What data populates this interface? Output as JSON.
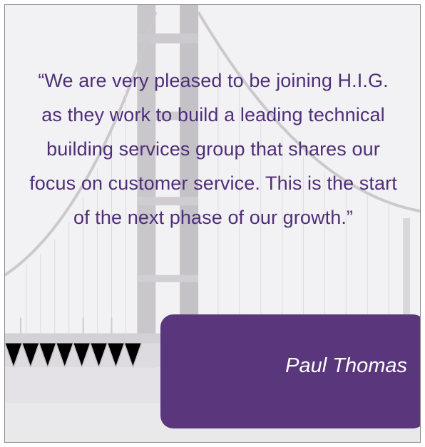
{
  "testimonial": {
    "quote": "“We are very pleased to be joining H.I.G. as they work to build a leading technical building services group that shares our focus on customer service. This is the start of the next phase of our growth.”",
    "author": "Paul Thomas"
  },
  "colors": {
    "quote_text": "#4f2f7a",
    "author_box": "#5a377c",
    "author_text": "#ffffff"
  },
  "icons": {
    "background_image": "suspension-bridge-photo"
  }
}
